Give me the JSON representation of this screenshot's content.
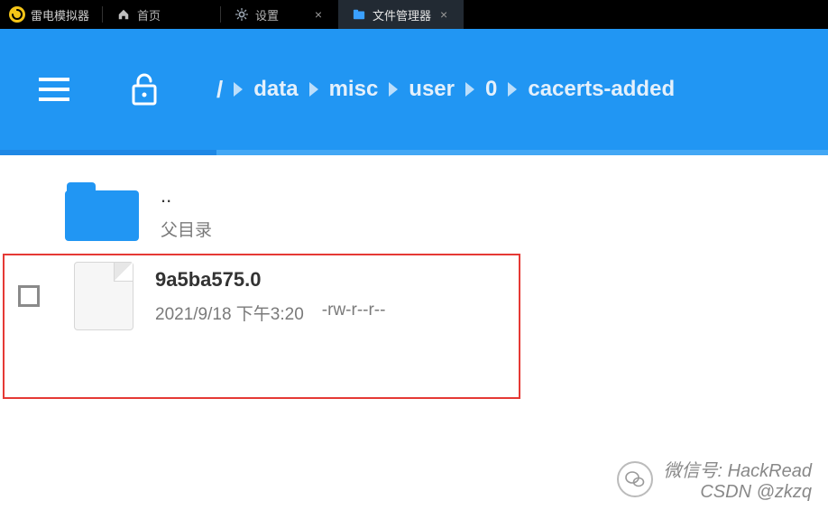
{
  "app": {
    "name": "雷电模拟器"
  },
  "tabs": [
    {
      "label": "首页",
      "icon": "home",
      "closeable": false
    },
    {
      "label": "设置",
      "icon": "gear",
      "closeable": true,
      "active": false
    },
    {
      "label": "文件管理器",
      "icon": "folder",
      "closeable": true,
      "active": true
    }
  ],
  "breadcrumb": {
    "root": "/",
    "segments": [
      "data",
      "misc",
      "user",
      "0",
      "cacerts-added"
    ]
  },
  "list": {
    "parent": {
      "dots": "..",
      "label": "父目录"
    },
    "items": [
      {
        "name": "9a5ba575.0",
        "date": "2021/9/18 下午3:20",
        "perm": "-rw-r--r--",
        "checked": false
      }
    ]
  },
  "watermark": {
    "line1": "微信号: HackRead",
    "line2": "CSDN @zkzq"
  }
}
